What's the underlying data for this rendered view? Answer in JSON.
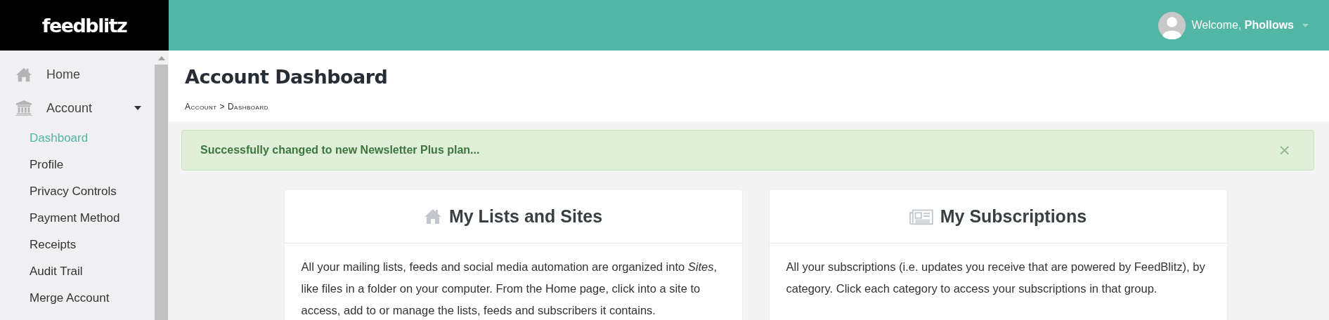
{
  "brand": {
    "logo": "feedblitz"
  },
  "user": {
    "greeting": "Welcome,",
    "name": "Phollows"
  },
  "sidebar": {
    "items": [
      {
        "label": "Home",
        "kind": "home",
        "selected": false
      },
      {
        "label": "Account",
        "kind": "bank",
        "selected": false,
        "expanded": true,
        "children": [
          {
            "label": "Dashboard",
            "selected": true
          },
          {
            "label": "Profile",
            "selected": false
          },
          {
            "label": "Privacy Controls",
            "selected": false
          },
          {
            "label": "Payment Method",
            "selected": false
          },
          {
            "label": "Receipts",
            "selected": false
          },
          {
            "label": "Audit Trail",
            "selected": false
          },
          {
            "label": "Merge Account",
            "selected": false
          }
        ]
      }
    ]
  },
  "page": {
    "title": "Account Dashboard",
    "breadcrumb": "Account > Dashboard"
  },
  "alert": {
    "message": "Successfully changed to new Newsletter Plus plan...",
    "close": "×"
  },
  "cards": [
    {
      "kind": "home",
      "title": "My Lists and Sites",
      "text": "All your mailing lists, feeds and social media automation are organized into *Sites*, like files in a folder on your computer. From the Home page, click into a site to access, add to or manage the lists, feeds and subscribers it contains."
    },
    {
      "kind": "newspaper",
      "title": "My Subscriptions",
      "text": "All your subscriptions (i.e. updates you receive that are powered by FeedBlitz), by category. Click each category to access your subscriptions in that group."
    }
  ]
}
